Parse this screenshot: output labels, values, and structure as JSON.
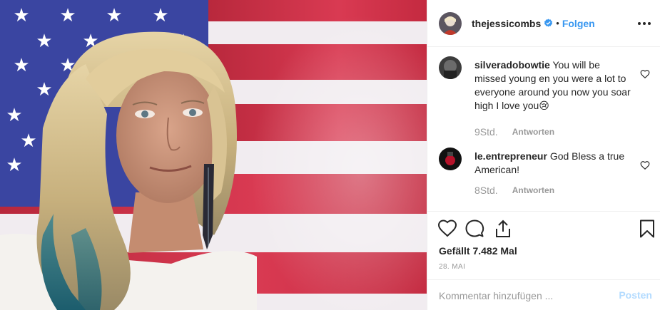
{
  "photo": {
    "description_icon": "selfie-photo",
    "flag_colors": {
      "canton": "#3a47a0",
      "stripe_red": "#cf2a43",
      "stripe_white": "#f2eef3"
    }
  },
  "header": {
    "username": "thejessicombs",
    "separator": "•",
    "follow_label": "Folgen",
    "verified_color": "#3897f0"
  },
  "comments": [
    {
      "username": "silveradobowtie",
      "text": "You will be missed young en you were a lot to everyone around you now you soar high I love you",
      "emoji": "😢",
      "time": "9Std.",
      "reply_label": "Antworten"
    },
    {
      "username": "le.entrepreneur",
      "text": "God Bless a true American!",
      "time": "8Std.",
      "reply_label": "Antworten"
    }
  ],
  "actions": {
    "likes": "Gefällt 7.482 Mal",
    "date": "28. MAI"
  },
  "composer": {
    "placeholder": "Kommentar hinzufügen ...",
    "post_label": "Posten"
  },
  "colors": {
    "link": "#3897f0",
    "muted": "#999999",
    "post_disabled": "#b3dbff"
  }
}
